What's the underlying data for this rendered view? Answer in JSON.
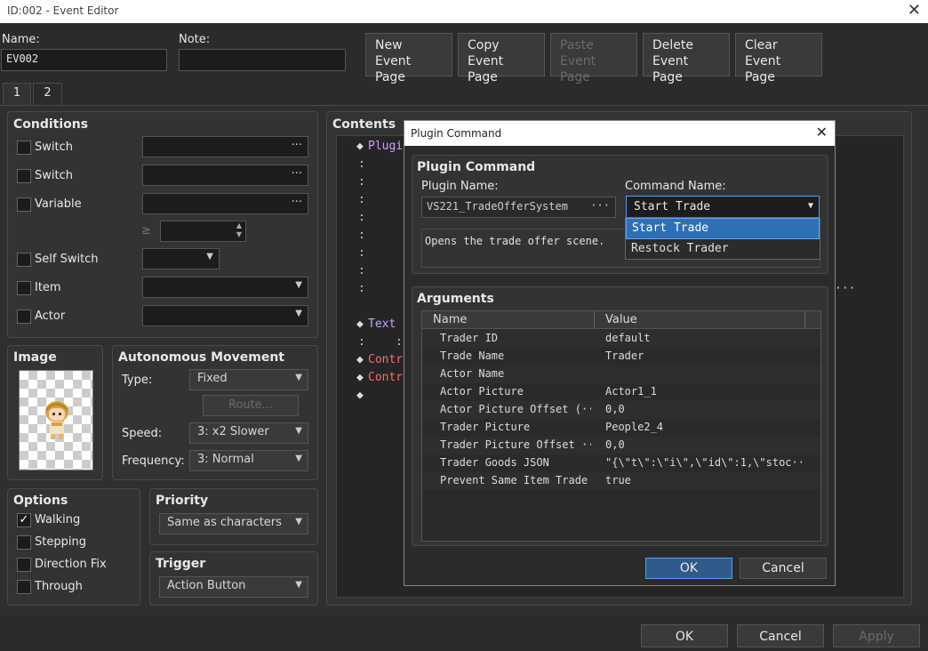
{
  "window": {
    "title": "ID:002 - Event Editor",
    "close": "✕"
  },
  "header": {
    "name_label": "Name:",
    "name_value": "EV002",
    "note_label": "Note:",
    "note_value": "",
    "buttons": [
      {
        "line1": "New",
        "line2": "Event Page",
        "enabled": true
      },
      {
        "line1": "Copy",
        "line2": "Event Page",
        "enabled": true
      },
      {
        "line1": "Paste",
        "line2": "Event Page",
        "enabled": false
      },
      {
        "line1": "Delete",
        "line2": "Event Page",
        "enabled": true
      },
      {
        "line1": "Clear",
        "line2": "Event Page",
        "enabled": true
      }
    ]
  },
  "tabs": [
    "1",
    "2"
  ],
  "conditions": {
    "title": "Conditions",
    "switch1": "Switch",
    "switch2": "Switch",
    "variable": "Variable",
    "ge": "≥",
    "self_switch": "Self Switch",
    "item": "Item",
    "actor": "Actor",
    "ellipsis": "···"
  },
  "image": {
    "title": "Image"
  },
  "movement": {
    "title": "Autonomous Movement",
    "type_label": "Type:",
    "type_value": "Fixed",
    "route_label": "Route...",
    "speed_label": "Speed:",
    "speed_value": "3: x2 Slower",
    "freq_label": "Frequency:",
    "freq_value": "3: Normal"
  },
  "options": {
    "title": "Options",
    "walking": "Walking",
    "stepping": "Stepping",
    "direction_fix": "Direction Fix",
    "through": "Through",
    "check": "✓"
  },
  "priority": {
    "title": "Priority",
    "value": "Same as characters"
  },
  "trigger": {
    "title": "Trigger",
    "value": "Action Button"
  },
  "contents": {
    "title": "Contents",
    "diamond": "◆",
    "colon": ":",
    "lines": {
      "plugin": "Plugin",
      "text": "Text :",
      "control1": "Contro",
      "control2": "Contro",
      "end": "◆",
      "ellipsis": "···"
    }
  },
  "dialog": {
    "title": "Plugin Command",
    "close": "✕",
    "group_title": "Plugin Command",
    "plugin_label": "Plugin Name:",
    "plugin_value": "VS221_TradeOfferSystem",
    "command_label": "Command Name:",
    "command_value": "Start Trade",
    "dropdown_options": [
      "Start Trade",
      "Restock Trader"
    ],
    "description": "Opens the trade offer scene.",
    "args_title": "Arguments",
    "col_name": "Name",
    "col_value": "Value",
    "args": [
      {
        "name": "Trader ID",
        "value": "default"
      },
      {
        "name": "Trade Name",
        "value": "Trader"
      },
      {
        "name": "Actor Name",
        "value": ""
      },
      {
        "name": "Actor Picture",
        "value": "Actor1_1"
      },
      {
        "name": "Actor Picture Offset (···",
        "value": "0,0"
      },
      {
        "name": "Trader Picture",
        "value": "People2_4"
      },
      {
        "name": "Trader Picture Offset ···",
        "value": "0,0"
      },
      {
        "name": "Trader Goods JSON",
        "value": "\"{\\\"t\\\":\\\"i\\\",\\\"id\\\":1,\\\"stoc···"
      },
      {
        "name": "Prevent Same Item Trade",
        "value": "true"
      }
    ],
    "ok": "OK",
    "cancel": "Cancel"
  },
  "footer": {
    "ok": "OK",
    "cancel": "Cancel",
    "apply": "Apply"
  }
}
